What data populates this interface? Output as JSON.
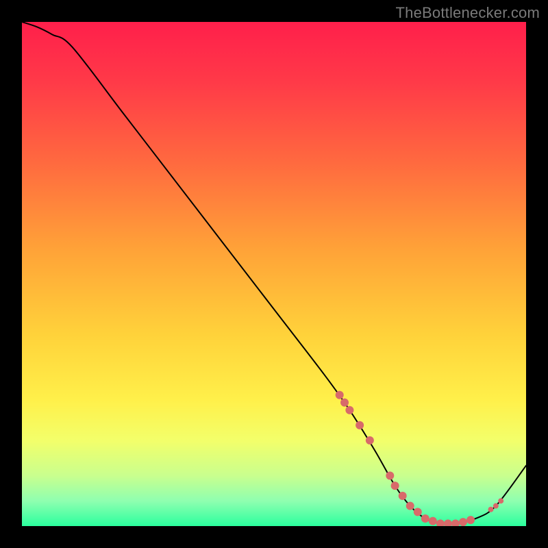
{
  "watermark": "TheBottlenecker.com",
  "chart_data": {
    "type": "line",
    "title": "",
    "xlabel": "",
    "ylabel": "",
    "xlim": [
      0,
      100
    ],
    "ylim": [
      0,
      100
    ],
    "x": [
      0,
      3,
      6,
      10,
      20,
      30,
      40,
      50,
      60,
      65,
      70,
      74,
      77,
      80,
      83,
      86,
      90,
      94,
      100
    ],
    "y": [
      100,
      99,
      97.5,
      95,
      82,
      69,
      56,
      43,
      30,
      23,
      15,
      8,
      4,
      1.5,
      0.5,
      0.5,
      1.5,
      4,
      12
    ],
    "marker_points": {
      "x": [
        63,
        64,
        65,
        67,
        69,
        73,
        74,
        75.5,
        77,
        78.5,
        80,
        81.5,
        83,
        84.5,
        86,
        87.5,
        89,
        93,
        94,
        95
      ],
      "y": [
        26,
        24.5,
        23,
        20,
        17,
        10,
        8,
        6,
        4,
        2.8,
        1.5,
        1.0,
        0.5,
        0.5,
        0.5,
        0.8,
        1.2,
        3.3,
        4,
        5
      ]
    },
    "gradient_stops": [
      {
        "offset": 0.0,
        "color": "#ff1f4b"
      },
      {
        "offset": 0.12,
        "color": "#ff3a48"
      },
      {
        "offset": 0.28,
        "color": "#ff6a3f"
      },
      {
        "offset": 0.45,
        "color": "#ffa238"
      },
      {
        "offset": 0.62,
        "color": "#ffd23a"
      },
      {
        "offset": 0.75,
        "color": "#fff04a"
      },
      {
        "offset": 0.83,
        "color": "#f3ff6a"
      },
      {
        "offset": 0.9,
        "color": "#c9ff8e"
      },
      {
        "offset": 0.95,
        "color": "#8fffb0"
      },
      {
        "offset": 1.0,
        "color": "#2bff9e"
      }
    ],
    "curve_color": "#000000",
    "marker_color": "#d86a6a",
    "marker_size_primary": 6,
    "marker_size_secondary": 4
  }
}
